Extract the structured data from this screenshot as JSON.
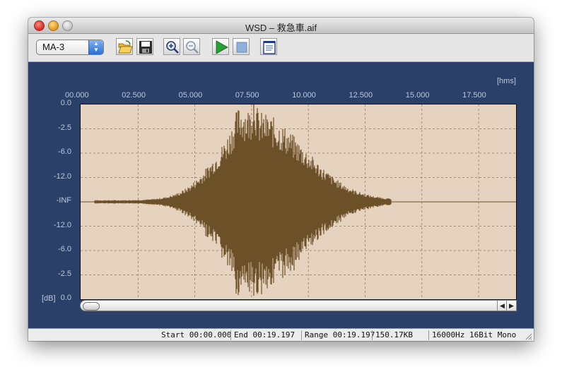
{
  "window": {
    "title": "WSD – 救急車.aif"
  },
  "toolbar": {
    "preset_value": "MA-3",
    "buttons": [
      {
        "name": "open-button",
        "icon": "folder-open-icon"
      },
      {
        "name": "save-button",
        "icon": "floppy-disk-icon"
      },
      {
        "name": "zoom-in-button",
        "icon": "zoom-in-icon"
      },
      {
        "name": "zoom-out-button",
        "icon": "zoom-out-icon"
      },
      {
        "name": "play-button",
        "icon": "play-icon"
      },
      {
        "name": "stop-button",
        "icon": "stop-icon"
      },
      {
        "name": "notes-button",
        "icon": "notepad-icon"
      }
    ]
  },
  "waveform": {
    "time_unit": "[hms]",
    "amp_unit": "[dB]",
    "time_ticks": [
      "00.000",
      "02.500",
      "05.000",
      "07.500",
      "10.000",
      "12.500",
      "15.000",
      "17.500"
    ],
    "amp_ticks": [
      "0.0",
      "-2.5",
      "-6.0",
      "-12.0",
      "-INF",
      "-12.0",
      "-6.0",
      "-2.5",
      "0.0"
    ],
    "colors": {
      "background": "#e5d3bf",
      "wave": "#6b5028",
      "grid": "#8a7a66",
      "panel": "#2b4068"
    }
  },
  "status": {
    "start": "Start 00:00.000",
    "end": "End 00:19.197",
    "range": "Range 00:19.197",
    "size": "150.17KB",
    "format": "16000Hz 16Bit Mono"
  }
}
